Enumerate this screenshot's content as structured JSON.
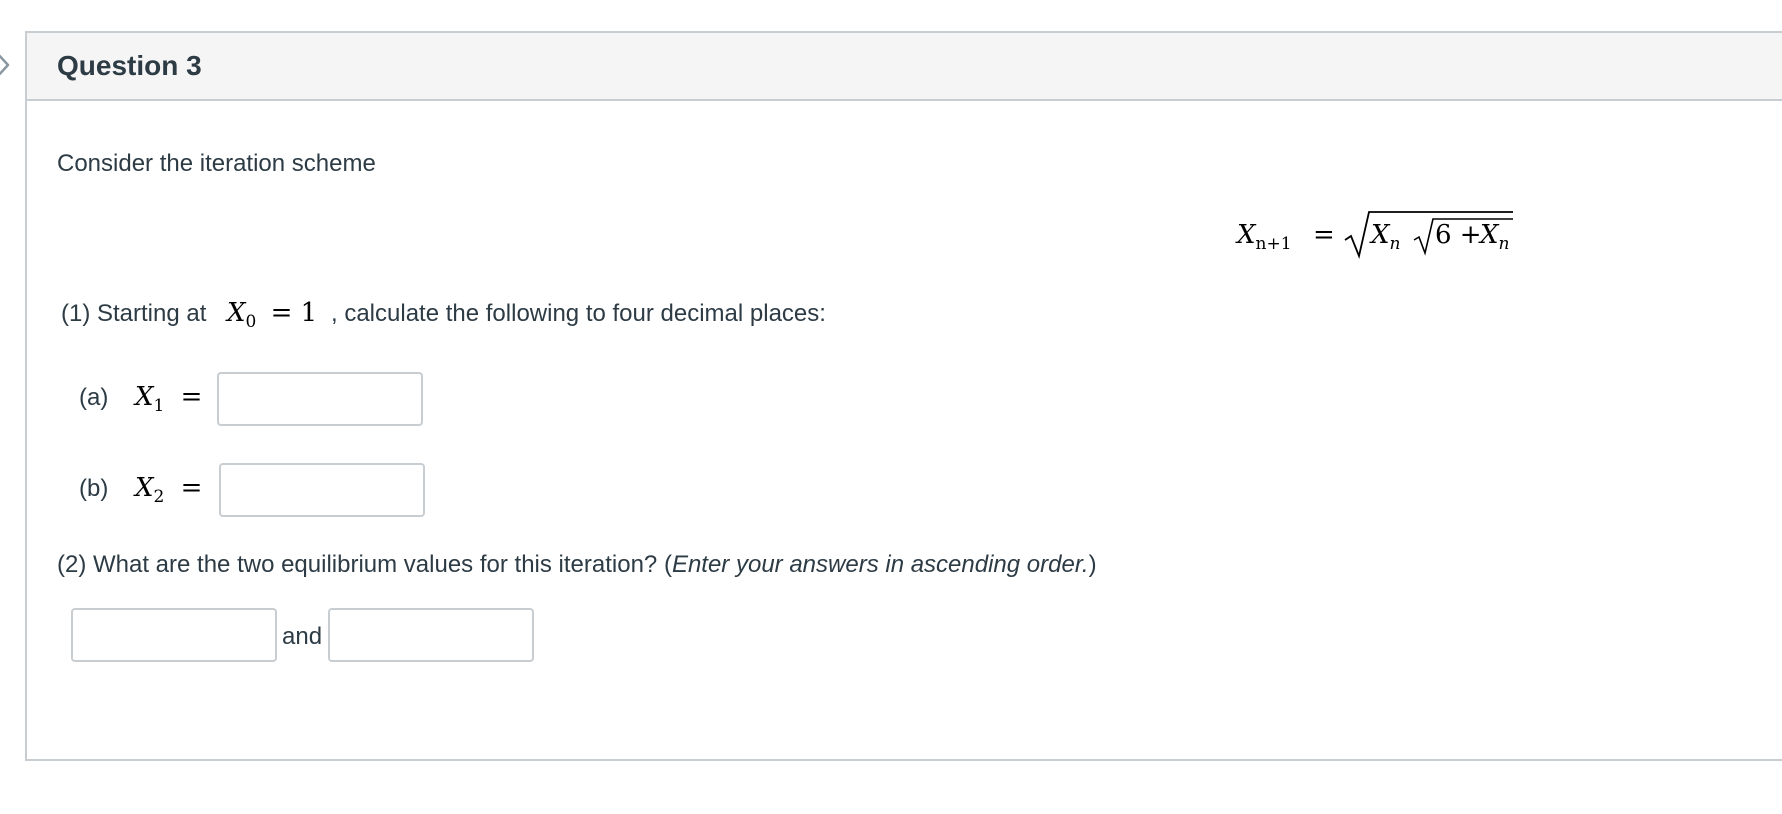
{
  "question": {
    "title": "Question 3",
    "intro": "Consider the iteration scheme",
    "formula": {
      "lhs_var": "X",
      "lhs_sub": "n+1",
      "equals": "=",
      "inner_var": "X",
      "inner_sub": "n",
      "six_plus": "6 +",
      "last_var": "X",
      "last_sub": "n"
    },
    "part1": {
      "prefix": "(1) Starting at",
      "start_var": "X",
      "start_sub": "0",
      "start_value": "= 1",
      "suffix": ", calculate the following to four decimal places:",
      "items": [
        {
          "label": "(a)",
          "var": "X",
          "sub": "1",
          "equals": "=",
          "value": ""
        },
        {
          "label": "(b)",
          "var": "X",
          "sub": "2",
          "equals": "=",
          "value": ""
        }
      ]
    },
    "part2": {
      "prefix": "(2) What are the two equilibrium values for this iteration?  (",
      "italic_note": "Enter your answers in ascending order.",
      "suffix": ")",
      "connector": "and",
      "answer1": "",
      "answer2": ""
    }
  },
  "colors": {
    "border": "#c7cdd1",
    "header_bg": "#f5f5f5",
    "text": "#2d3b45"
  }
}
